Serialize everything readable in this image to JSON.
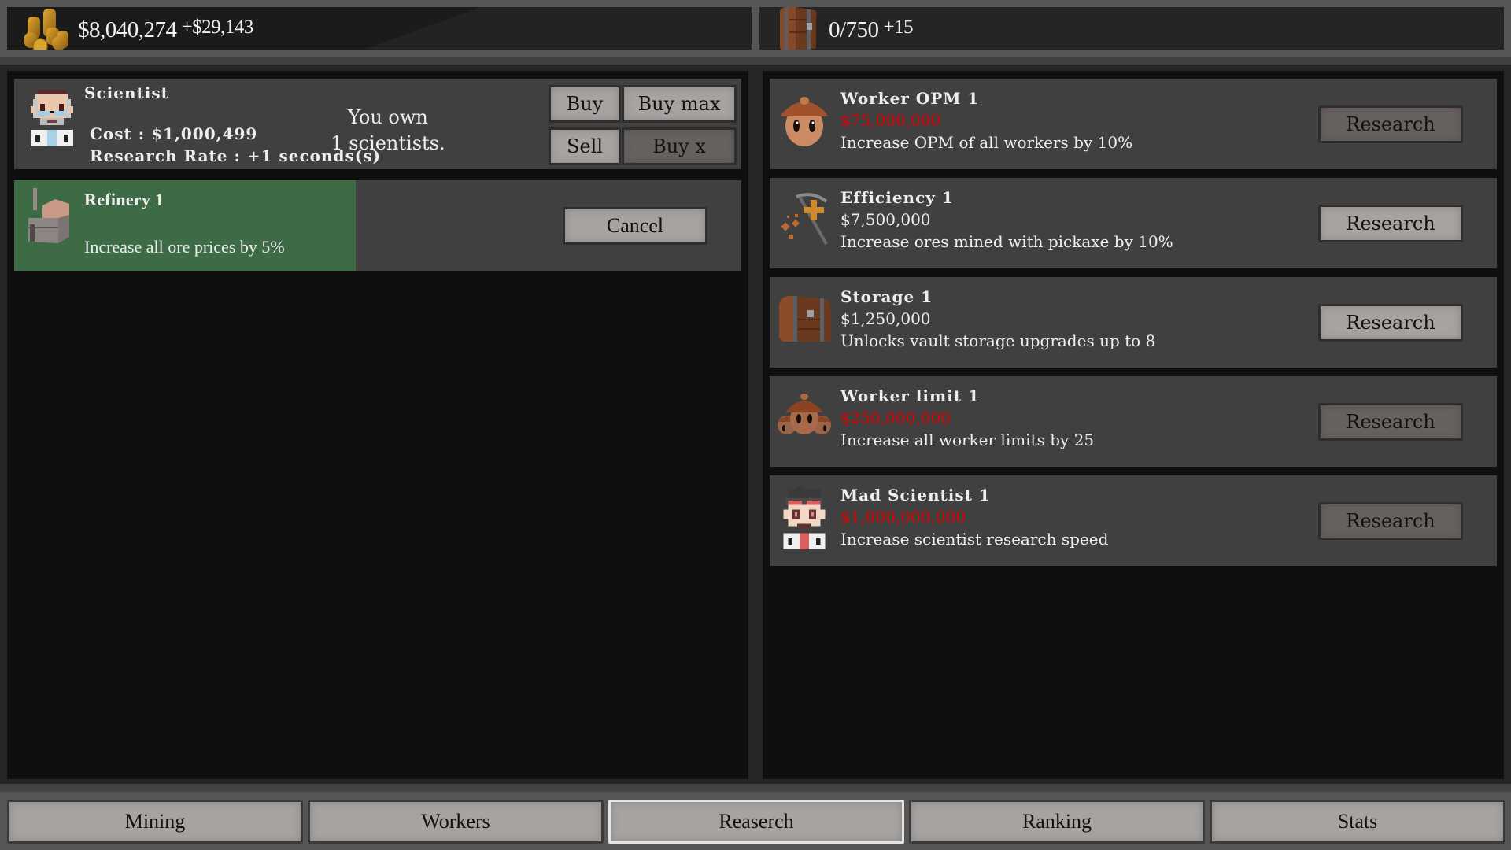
{
  "header": {
    "money": {
      "icon": "gold-coins-icon",
      "value": "$8,040,274",
      "delta": "+$29,143"
    },
    "storage": {
      "icon": "chest-icon",
      "value": "0/750",
      "delta": "+15"
    }
  },
  "scientist": {
    "icon": "scientist-avatar-icon",
    "title": "Scientist",
    "cost": "Cost : $1,000,499",
    "rate": "Research Rate : +1 seconds(s)",
    "owned_line1": "You own",
    "owned_line2": "1 scientists.",
    "buttons": {
      "buy": "Buy",
      "buy_max": "Buy max",
      "sell": "Sell",
      "buy_x": "Buy x"
    }
  },
  "active_research": {
    "icon": "refinery-icon",
    "name": "Refinery 1",
    "description": "Increase all ore prices by 5%",
    "progress_percent": 47,
    "cancel_label": "Cancel"
  },
  "research_list": [
    {
      "icon": "worker-icon",
      "name": "Worker OPM 1",
      "price": "$75,000,000",
      "affordable": false,
      "description": "Increase OPM of all workers by 10%",
      "button": "Research"
    },
    {
      "icon": "pickaxe-plus-icon",
      "name": "Efficiency 1",
      "price": "$7,500,000",
      "affordable": true,
      "description": "Increase ores mined with pickaxe by 10%",
      "button": "Research"
    },
    {
      "icon": "chest-icon",
      "name": "Storage 1",
      "price": "$1,250,000",
      "affordable": true,
      "description": "Unlocks vault storage upgrades up to 8",
      "button": "Research"
    },
    {
      "icon": "worker-group-icon",
      "name": "Worker limit 1",
      "price": "$250,000,000",
      "affordable": false,
      "description": "Increase all worker limits by 25",
      "button": "Research"
    },
    {
      "icon": "mad-scientist-icon",
      "name": "Mad Scientist 1",
      "price": "$1,000,000,000",
      "affordable": false,
      "description": "Increase scientist research speed",
      "button": "Research"
    }
  ],
  "nav": {
    "active": "Reaserch",
    "tabs": [
      "Mining",
      "Workers",
      "Reaserch",
      "Ranking",
      "Stats"
    ]
  },
  "colors": {
    "unaffordable_price": "#e00000",
    "progress_fill": "#3c6b46",
    "panel_bg": "#404040"
  }
}
